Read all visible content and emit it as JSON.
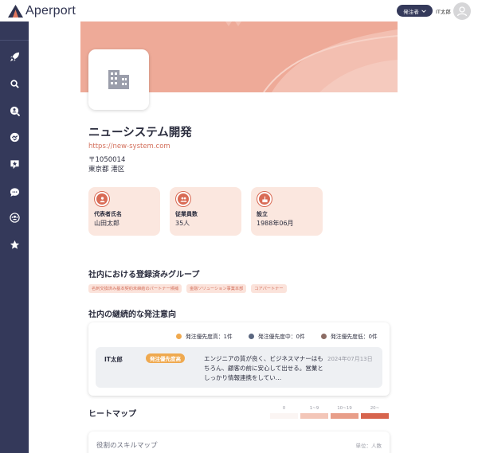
{
  "app": {
    "logo_text": "Aperport"
  },
  "header": {
    "role_label": "発注者",
    "user_name": "IT太郎"
  },
  "sidebar": {
    "items": [
      {
        "icon": "rocket-icon"
      },
      {
        "icon": "search-icon"
      },
      {
        "icon": "search-person-icon"
      },
      {
        "icon": "handshake-icon"
      },
      {
        "icon": "review-star-icon"
      },
      {
        "icon": "chat-icon"
      },
      {
        "icon": "group-icon"
      },
      {
        "icon": "star-icon"
      }
    ]
  },
  "company": {
    "name": "ニューシステム開発",
    "url": "https://new-system.com",
    "postal": "〒1050014",
    "address": "東京都 港区"
  },
  "info_cards": [
    {
      "label": "代表者氏名",
      "value": "山田太郎",
      "icon": "person-icon"
    },
    {
      "label": "従業員数",
      "value": "35人",
      "icon": "people-icon"
    },
    {
      "label": "設立",
      "value": "1988年06月",
      "icon": "cake-icon"
    }
  ],
  "groups": {
    "title": "社内における登録済みグループ",
    "tags": [
      "名刺交換済み基本契約未締結のパートナー候補",
      "金融ソリューション事業本部",
      "コアパートナー"
    ]
  },
  "intent": {
    "title": "社内の継続的な発注意向",
    "legend": [
      {
        "label": "発注優先度高：1件",
        "color": "#f0a94e"
      },
      {
        "label": "発注優先度中：0件",
        "color": "#5b6780"
      },
      {
        "label": "発注優先度低：0件",
        "color": "#8c6c64"
      }
    ],
    "entry": {
      "name": "IT太郎",
      "badge": "発注優先度高",
      "comment": "エンジニアの質が良く、ビジネスマナーはもちろん、顧客の前に安心して出せる。営業としっかり情報連携をしてい…",
      "date": "2024年07月13日"
    }
  },
  "heatmap": {
    "title": "ヒートマップ",
    "scale": [
      {
        "label": "0",
        "color": "#fbf5f3"
      },
      {
        "label": "1~9",
        "color": "#f3c6b8"
      },
      {
        "label": "10~19",
        "color": "#e89e89"
      },
      {
        "label": "20~",
        "color": "#d7644d"
      }
    ]
  },
  "skill_map": {
    "title": "役割のスキルマップ",
    "unit": "単位：人数"
  },
  "colors": {
    "sidebar": "#34395a",
    "accent": "#d3705c",
    "banner": "#eeaa98"
  }
}
